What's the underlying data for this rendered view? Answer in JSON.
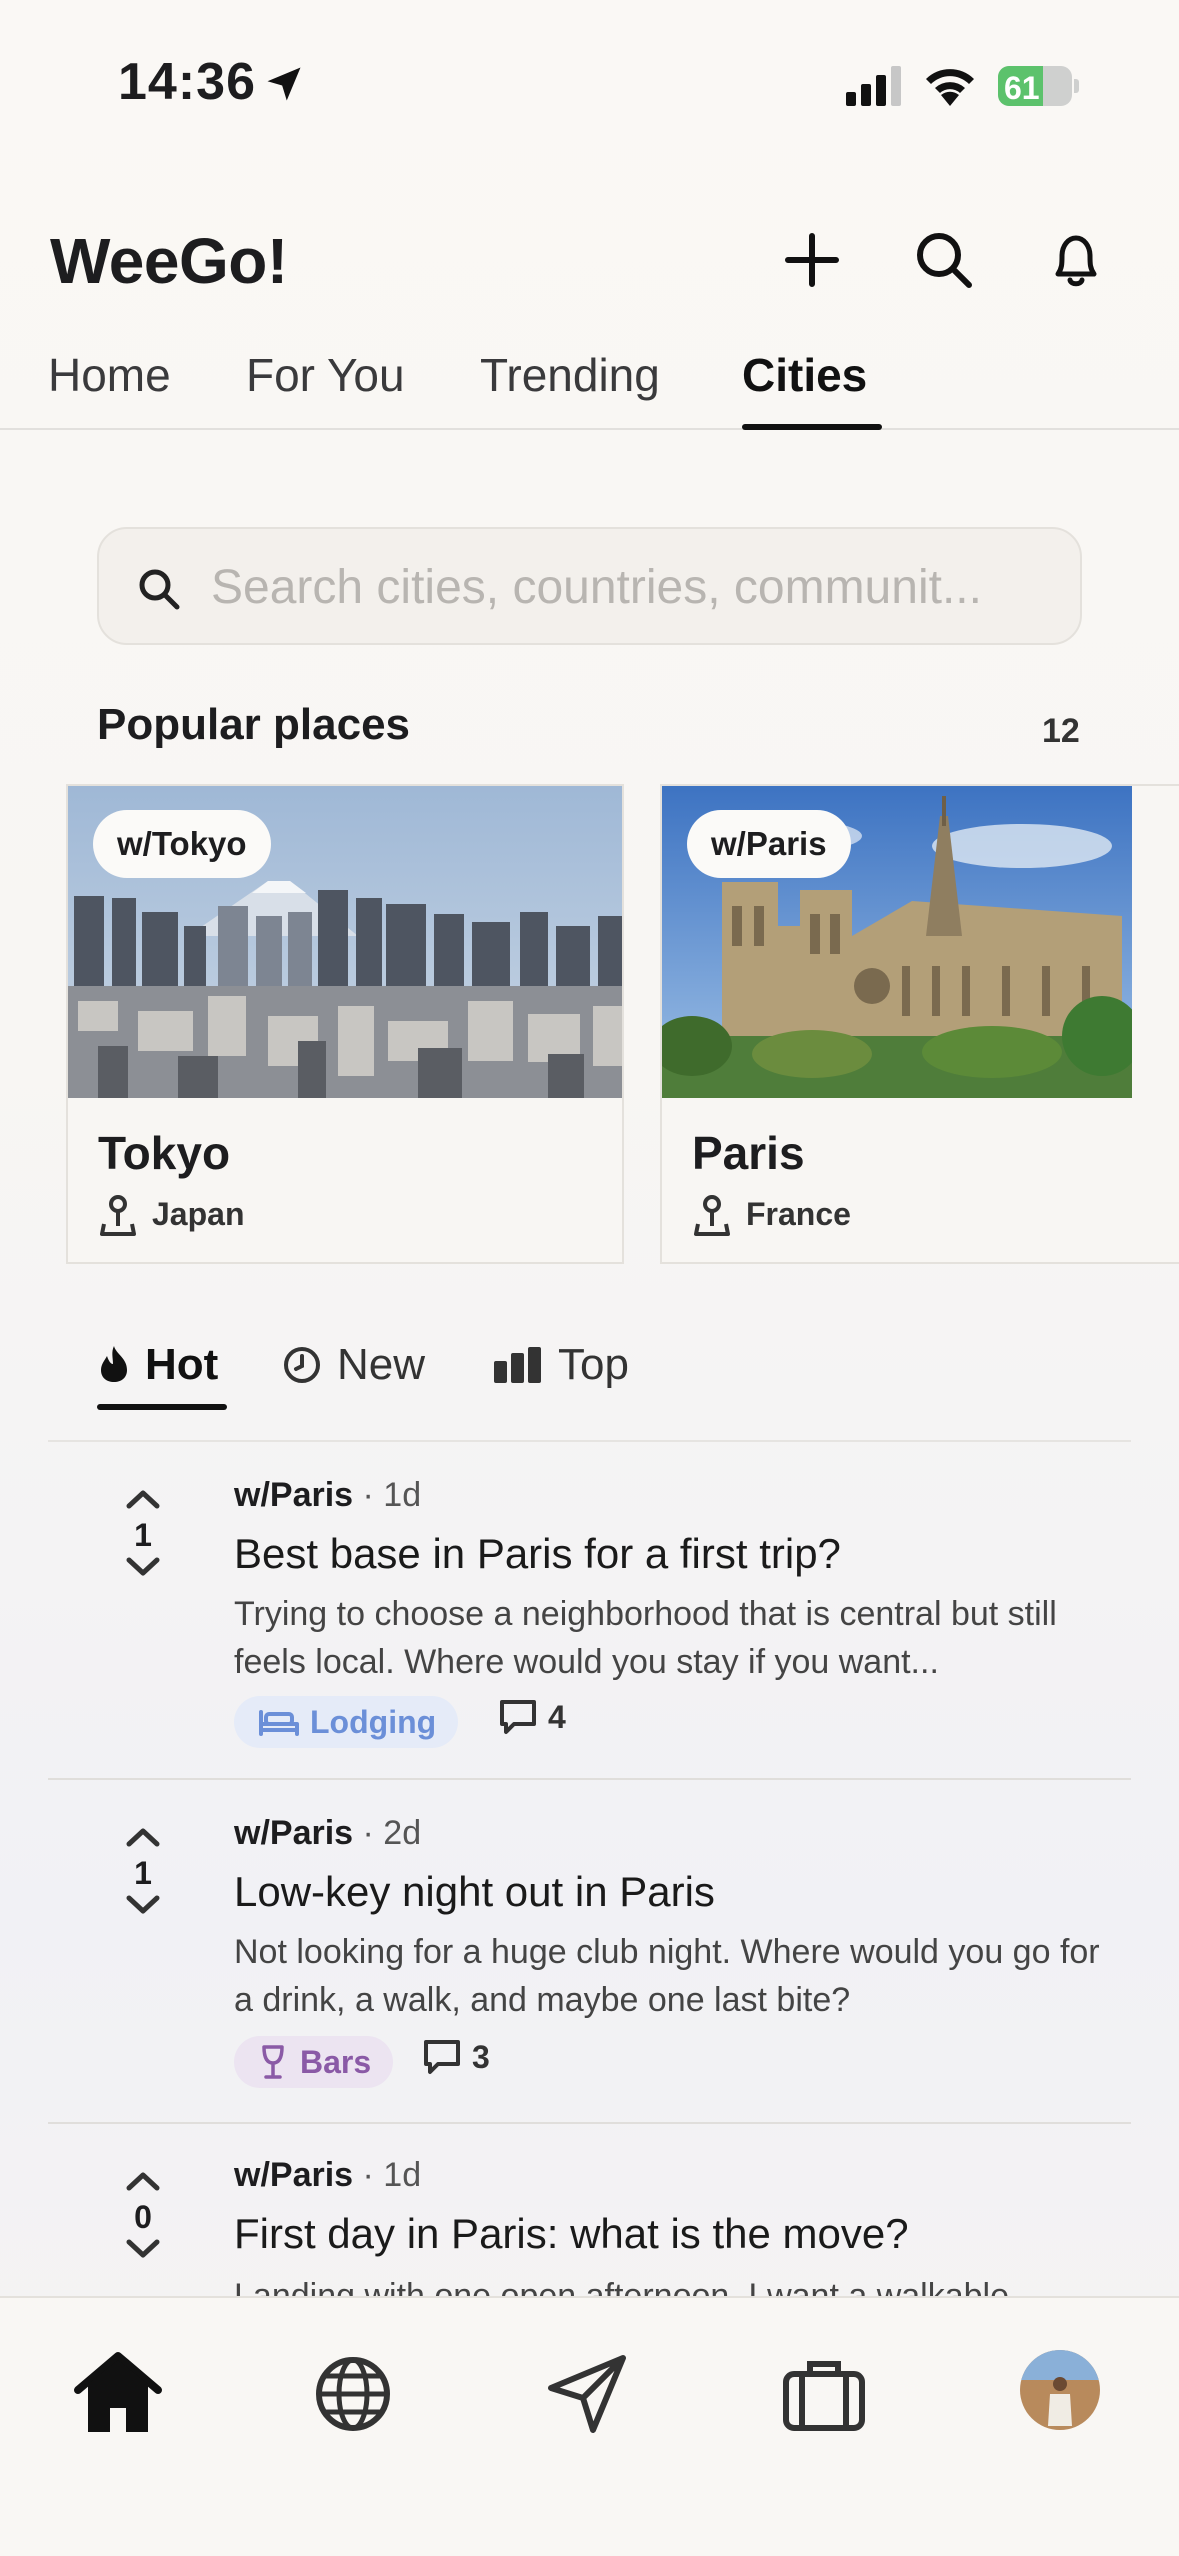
{
  "status_bar": {
    "time": "14:36",
    "battery": "61",
    "battery_level": 0.61
  },
  "header": {
    "app_title": "WeeGo!"
  },
  "tabs": [
    {
      "label": "Home"
    },
    {
      "label": "For You"
    },
    {
      "label": "Trending"
    },
    {
      "label": "Cities",
      "active": true
    }
  ],
  "search": {
    "placeholder": "Search cities, countries, communit..."
  },
  "popular": {
    "title": "Popular places",
    "count": "12",
    "cards": [
      {
        "community": "w/Tokyo",
        "city": "Tokyo",
        "country": "Japan"
      },
      {
        "community": "w/Paris",
        "city": "Paris",
        "country": "France"
      }
    ]
  },
  "sort_tabs": [
    {
      "label": "Hot",
      "icon": "flame-icon",
      "active": true
    },
    {
      "label": "New",
      "icon": "clock-icon"
    },
    {
      "label": "Top",
      "icon": "bars-icon"
    }
  ],
  "posts": [
    {
      "votes": "1",
      "community": "w/Paris",
      "age": "· 1d",
      "title": "Best base in Paris for a first trip?",
      "body": "Trying to choose a neighborhood that is central but still feels local. Where would you stay if you want...",
      "tag": "Lodging",
      "tag_icon": "bed-icon",
      "comments": "4"
    },
    {
      "votes": "1",
      "community": "w/Paris",
      "age": "· 2d",
      "title": "Low-key night out in Paris",
      "body": "Not looking for a huge club night. Where would you go for a drink, a walk, and maybe one last bite?",
      "tag": "Bars",
      "tag_icon": "wine-glass-icon",
      "comments": "3"
    },
    {
      "votes": "0",
      "community": "w/Paris",
      "age": "· 1d",
      "title": "First day in Paris: what is the move?",
      "body": "Landing with one open afternoon. I want a walkable"
    }
  ],
  "bottom_nav": [
    {
      "icon": "home-icon",
      "active": true
    },
    {
      "icon": "globe-icon"
    },
    {
      "icon": "paper-plane-icon"
    },
    {
      "icon": "briefcase-icon"
    },
    {
      "icon": "avatar"
    }
  ],
  "colors": {
    "lodging_tag_bg": "#e5ebf8",
    "lodging_tag_text": "#6b8fd8",
    "bars_tag_bg": "#ece4f1",
    "bars_tag_text": "#8a5aa6",
    "battery_green": "#5cc26c"
  }
}
